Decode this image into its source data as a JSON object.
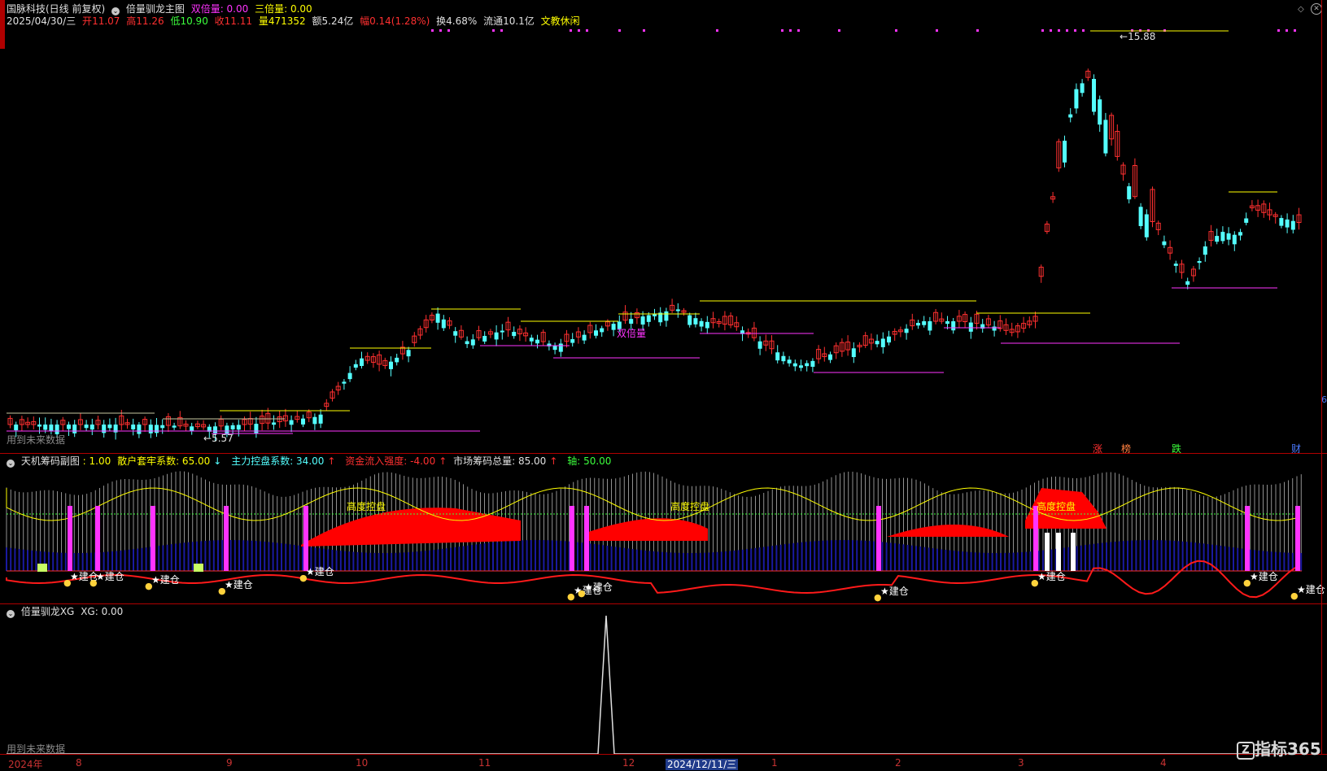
{
  "main_panel": {
    "stock": "国脉科技(日线 前复权)",
    "indicator": "倍量驯龙主图",
    "double_label": "双倍量: 0.00",
    "triple_label": "三倍量: 0.00",
    "date": "2025/04/30/三",
    "open_label": "开",
    "open": "11.07",
    "high_label": "高",
    "high": "11.26",
    "low_label": "低",
    "low": "10.90",
    "close_label": "收",
    "close": "11.11",
    "vol_label": "量",
    "vol": "471352",
    "amount": "额5.24亿",
    "change": "幅0.14(1.28%)",
    "turnover": "换4.68%",
    "float": "流通10.1亿",
    "sector": "文教休闲",
    "future_note": "用到未来数据",
    "high_mark": "15.88",
    "low_mark": "5.57",
    "double_volume_tag": "双倍量",
    "bottom_tags": [
      "涨",
      "榜",
      "跌",
      "财"
    ],
    "right_edge_label": "6"
  },
  "sub_panel": {
    "title": "天机筹码副图",
    "value": ": 1.00",
    "retail": "散户套牢系数: 65.00",
    "main_force": "主力控盘系数: 34.00",
    "capital": "资金流入强度: -4.00",
    "total": "市场筹码总量: 85.00",
    "axis": "轴: 50.00",
    "high_control": "高度控盘",
    "build": "建仓"
  },
  "xg_panel": {
    "title": "倍量驯龙XG",
    "value": "XG: 0.00",
    "future_note": "用到未来数据"
  },
  "axis": {
    "year": "2024年",
    "months": [
      "8",
      "9",
      "10",
      "11",
      "12",
      "1",
      "2",
      "3",
      "4"
    ],
    "selected_date": "2024/12/11/三"
  },
  "brand": "指标365",
  "colors": {
    "bg": "#000000",
    "up": "#ff3030",
    "down": "#54ffff",
    "border": "#b00000",
    "yellow": "#ffff00",
    "magenta": "#ff33ff"
  }
}
